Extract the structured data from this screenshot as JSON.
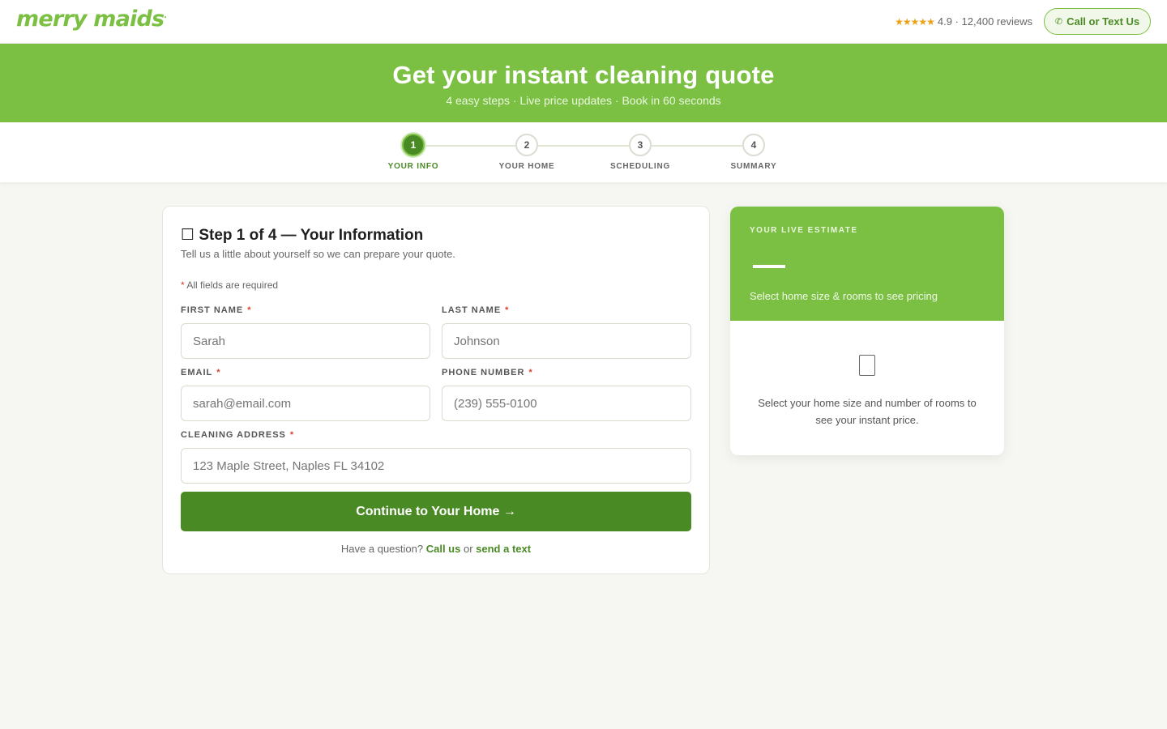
{
  "header": {
    "logo_text": "merry maids",
    "logo_mark": ".",
    "rating_stars": "★★★★★",
    "rating_text": "4.9 · 12,400 reviews",
    "call_icon": "phone-icon",
    "call_label": "Call or Text Us"
  },
  "hero": {
    "title": "Get your instant cleaning quote",
    "subtitle": "4 easy steps · Live price updates · Book in 60 seconds"
  },
  "stepper": {
    "current_step": 1,
    "steps": [
      {
        "number": "1",
        "label": "YOUR INFO"
      },
      {
        "number": "2",
        "label": "YOUR HOME"
      },
      {
        "number": "3",
        "label": "SCHEDULING"
      },
      {
        "number": "4",
        "label": "SUMMARY"
      }
    ]
  },
  "form": {
    "title_icon": "person-icon",
    "title": "Step 1 of 4 — Your Information",
    "subtitle": "Tell us a little about yourself so we can prepare your quote.",
    "required_star": "*",
    "required_note": "All fields are required",
    "fields": {
      "first_name": {
        "label": "FIRST NAME",
        "placeholder": "Sarah",
        "value": ""
      },
      "last_name": {
        "label": "LAST NAME",
        "placeholder": "Johnson",
        "value": ""
      },
      "email": {
        "label": "EMAIL",
        "placeholder": "sarah@email.com",
        "value": ""
      },
      "phone": {
        "label": "PHONE NUMBER",
        "placeholder": "(239) 555-0100",
        "value": ""
      },
      "address": {
        "label": "CLEANING ADDRESS",
        "placeholder": "123 Maple Street, Naples FL 34102",
        "value": ""
      }
    },
    "submit_label": "Continue to Your Home →",
    "help_prefix": "Have a question?",
    "help_call": "Call us",
    "help_or": "or",
    "help_text": "send a text"
  },
  "estimate": {
    "kicker": "YOUR LIVE ESTIMATE",
    "hint": "Select home size & rooms to see pricing",
    "icon": "home-icon",
    "body": "Select your home size and number of rooms to see your instant price."
  },
  "colors": {
    "brand_green": "#7bc043",
    "dark_green": "#4a8a24",
    "required_red": "#d9412c",
    "star_gold": "#e8a317",
    "page_bg": "#f6f7f2"
  }
}
